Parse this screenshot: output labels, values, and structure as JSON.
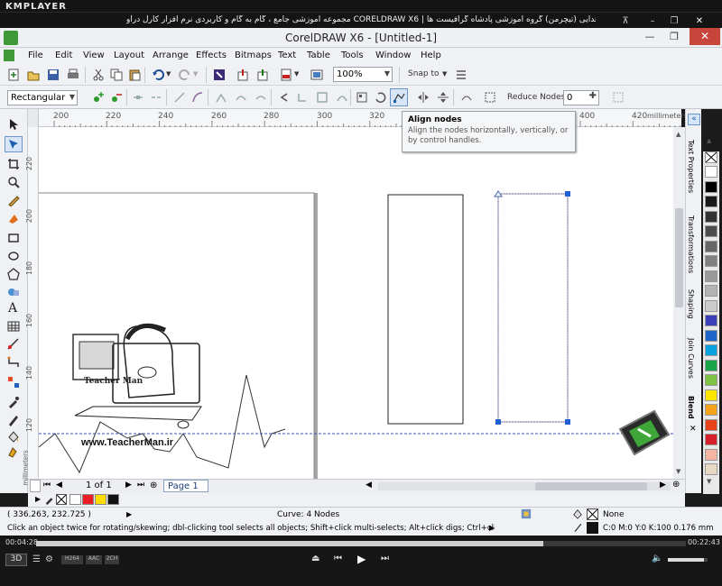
{
  "player": {
    "logo": "KMPLAYER",
    "title": "مجموعه آموزشی جامع ، گام به گام و کاربردی نرم افزار کارل دراو  CORELDRAW X6  |  مدرس : سعید هدایی (تیچرمن) گروه آموزشی پادشاه گرافیست ها",
    "elapsed": "00:04:28",
    "total": "00:22:43",
    "progress": 0.78,
    "badges": [
      "3D",
      "H264",
      "AAC",
      "2CH"
    ],
    "icons": [
      "pin-icon",
      "minimize-icon",
      "restore-icon",
      "close-icon",
      "playlist-icon",
      "settings-icon",
      "eject-icon",
      "prev-icon",
      "play-icon",
      "next-icon",
      "volume-icon"
    ]
  },
  "window": {
    "title": "CorelDRAW X6 - [Untitled-1]"
  },
  "menu": [
    "File",
    "Edit",
    "View",
    "Layout",
    "Arrange",
    "Effects",
    "Bitmaps",
    "Text",
    "Table",
    "Tools",
    "Window",
    "Help"
  ],
  "standard_toolbar": {
    "zoom": "100%",
    "snap": "Snap to"
  },
  "property_bar": {
    "selection_mode": "Rectangular",
    "reduce_label": "Reduce Nodes",
    "reduce_value": "0"
  },
  "tooltip": {
    "title": "Align nodes",
    "body": "Align the nodes horizontally, vertically, or by control handles."
  },
  "ruler": {
    "units": "millimeters",
    "top_ticks": [
      "200",
      "220",
      "240",
      "260",
      "280",
      "300",
      "320",
      "340",
      "360",
      "380",
      "400",
      "420"
    ],
    "left_ticks": [
      "220",
      "200",
      "180",
      "160",
      "140",
      "120"
    ]
  },
  "canvas": {
    "watermark_url": "www.TeacherMan.ir",
    "watermark_brand": "Teacher Man"
  },
  "dockers": [
    "Text Properties",
    "Transformations",
    "Shaping",
    "Join Curves",
    "Blend"
  ],
  "page_nav": {
    "pages": "1 of 1",
    "tab": "Page 1"
  },
  "status": {
    "coords": "( 336.263, 232.725 )",
    "object": "Curve: 4 Nodes",
    "hint": "Click an object twice for rotating/skewing; dbl-clicking tool selects all objects; Shift+click multi-selects; Alt+click digs; Ctrl+click selects in a group",
    "fill": "None",
    "outline": "C:0 M:0 Y:0 K:100  0.176 mm"
  },
  "palette_colors": [
    "#ffffff",
    "#000000",
    "#1a1a1a",
    "#333333",
    "#4d4d4d",
    "#666666",
    "#808080",
    "#999999",
    "#b3b3b3",
    "#cccccc",
    "#3a3fb8",
    "#1f66c9",
    "#0aa1e0",
    "#1aa54a",
    "#7dc242",
    "#ffe600",
    "#f7a21b",
    "#e8421c",
    "#d62029",
    "#f6b5a3",
    "#e8d9c4"
  ],
  "doc_palette": [
    "#ffffff",
    "#ee1c24",
    "#ffdd00",
    "#111111"
  ]
}
